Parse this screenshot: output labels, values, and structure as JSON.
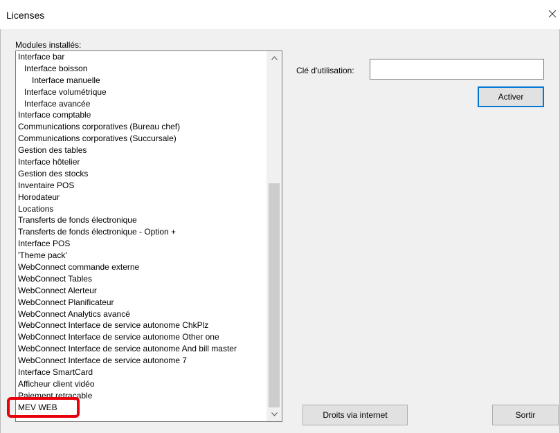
{
  "window": {
    "title": "Licenses"
  },
  "modules": {
    "label": "Modules installés:",
    "items": [
      {
        "label": "Interface bar",
        "indent": 0
      },
      {
        "label": "Interface boisson",
        "indent": 1
      },
      {
        "label": "Interface manuelle",
        "indent": 2
      },
      {
        "label": "Interface volumétrique",
        "indent": 1
      },
      {
        "label": "Interface avancée",
        "indent": 1
      },
      {
        "label": "Interface comptable",
        "indent": 0
      },
      {
        "label": "Communications corporatives (Bureau chef)",
        "indent": 0
      },
      {
        "label": "Communications corporatives (Succursale)",
        "indent": 0
      },
      {
        "label": "Gestion des tables",
        "indent": 0
      },
      {
        "label": "Interface hôtelier",
        "indent": 0
      },
      {
        "label": "Gestion des stocks",
        "indent": 0
      },
      {
        "label": "Inventaire POS",
        "indent": 0
      },
      {
        "label": "Horodateur",
        "indent": 0
      },
      {
        "label": "Locations",
        "indent": 0
      },
      {
        "label": "Transferts de fonds électronique",
        "indent": 0
      },
      {
        "label": "Transferts de fonds électronique - Option +",
        "indent": 0
      },
      {
        "label": "Interface POS",
        "indent": 0
      },
      {
        "label": "'Theme pack'",
        "indent": 0
      },
      {
        "label": "WebConnect commande externe",
        "indent": 0
      },
      {
        "label": "WebConnect Tables",
        "indent": 0
      },
      {
        "label": "WebConnect Alerteur",
        "indent": 0
      },
      {
        "label": "WebConnect Planificateur",
        "indent": 0
      },
      {
        "label": "WebConnect Analytics avancé",
        "indent": 0
      },
      {
        "label": "WebConnect Interface de service autonome ChkPlz",
        "indent": 0
      },
      {
        "label": "WebConnect Interface de service autonome Other one",
        "indent": 0
      },
      {
        "label": "WebConnect Interface de service autonome And bill master",
        "indent": 0
      },
      {
        "label": "WebConnect Interface de service autonome 7",
        "indent": 0
      },
      {
        "label": "Interface SmartCard",
        "indent": 0
      },
      {
        "label": "Afficheur client vidéo",
        "indent": 0
      },
      {
        "label": "Paiement retraçable",
        "indent": 0
      },
      {
        "label": "MEV WEB",
        "indent": 0
      }
    ]
  },
  "license": {
    "key_label": "Clé d'utilisation:",
    "key_value": "",
    "activate_label": "Activer"
  },
  "footer": {
    "internet_rights_label": "Droits via internet",
    "exit_label": "Sortir"
  },
  "colors": {
    "highlight": "#e8000b",
    "focus_border": "#0078d7"
  },
  "icons": {
    "close": "close-icon",
    "scroll_up": "chevron-up-icon",
    "scroll_down": "chevron-down-icon"
  }
}
